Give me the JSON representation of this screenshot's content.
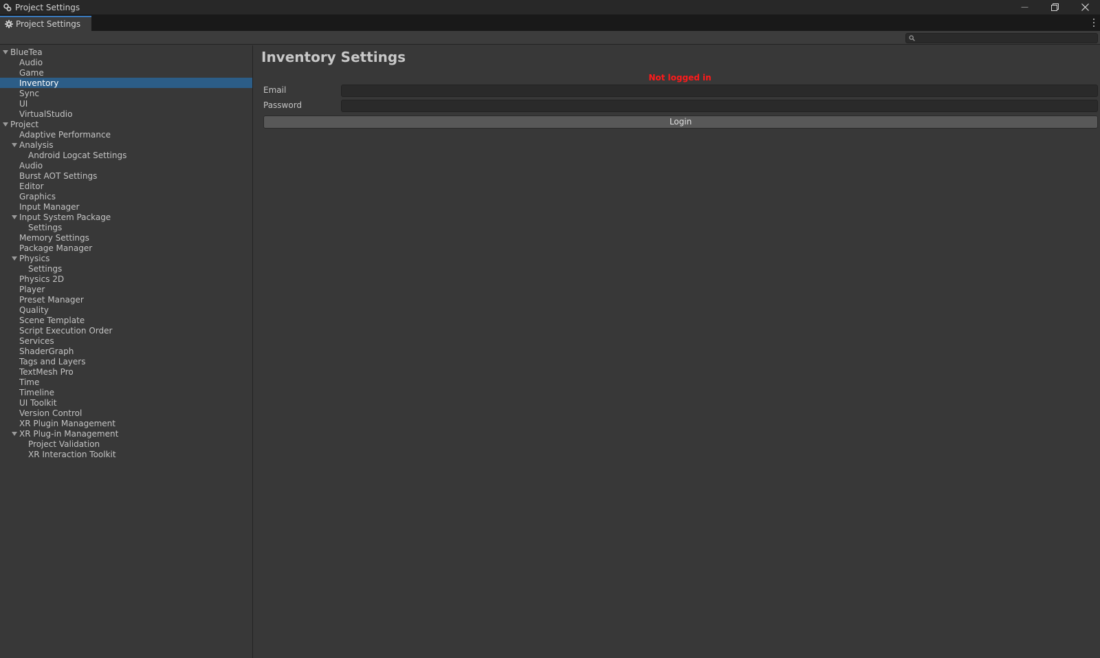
{
  "window": {
    "title": "Project Settings",
    "controls": {
      "minimize": "—",
      "restore": "❐",
      "close": "✕"
    }
  },
  "tab": {
    "label": "Project Settings"
  },
  "search": {
    "placeholder": ""
  },
  "sidebar": {
    "items": [
      {
        "label": "BlueTea",
        "level": 0,
        "expanded": true,
        "selected": false
      },
      {
        "label": "Audio",
        "level": 1,
        "selected": false
      },
      {
        "label": "Game",
        "level": 1,
        "selected": false
      },
      {
        "label": "Inventory",
        "level": 1,
        "selected": true
      },
      {
        "label": "Sync",
        "level": 1,
        "selected": false
      },
      {
        "label": "UI",
        "level": 1,
        "selected": false
      },
      {
        "label": "VirtualStudio",
        "level": 1,
        "selected": false
      },
      {
        "label": "Project",
        "level": 0,
        "expanded": true,
        "selected": false
      },
      {
        "label": "Adaptive Performance",
        "level": 1,
        "selected": false
      },
      {
        "label": "Analysis",
        "level": 1,
        "expanded": true,
        "selected": false
      },
      {
        "label": "Android Logcat Settings",
        "level": 2,
        "selected": false
      },
      {
        "label": "Audio",
        "level": 1,
        "selected": false
      },
      {
        "label": "Burst AOT Settings",
        "level": 1,
        "selected": false
      },
      {
        "label": "Editor",
        "level": 1,
        "selected": false
      },
      {
        "label": "Graphics",
        "level": 1,
        "selected": false
      },
      {
        "label": "Input Manager",
        "level": 1,
        "selected": false
      },
      {
        "label": "Input System Package",
        "level": 1,
        "expanded": true,
        "selected": false
      },
      {
        "label": "Settings",
        "level": 2,
        "selected": false
      },
      {
        "label": "Memory Settings",
        "level": 1,
        "selected": false
      },
      {
        "label": "Package Manager",
        "level": 1,
        "selected": false
      },
      {
        "label": "Physics",
        "level": 1,
        "expanded": true,
        "selected": false
      },
      {
        "label": "Settings",
        "level": 2,
        "selected": false
      },
      {
        "label": "Physics 2D",
        "level": 1,
        "selected": false
      },
      {
        "label": "Player",
        "level": 1,
        "selected": false
      },
      {
        "label": "Preset Manager",
        "level": 1,
        "selected": false
      },
      {
        "label": "Quality",
        "level": 1,
        "selected": false
      },
      {
        "label": "Scene Template",
        "level": 1,
        "selected": false
      },
      {
        "label": "Script Execution Order",
        "level": 1,
        "selected": false
      },
      {
        "label": "Services",
        "level": 1,
        "selected": false
      },
      {
        "label": "ShaderGraph",
        "level": 1,
        "selected": false
      },
      {
        "label": "Tags and Layers",
        "level": 1,
        "selected": false
      },
      {
        "label": "TextMesh Pro",
        "level": 1,
        "selected": false
      },
      {
        "label": "Time",
        "level": 1,
        "selected": false
      },
      {
        "label": "Timeline",
        "level": 1,
        "selected": false
      },
      {
        "label": "UI Toolkit",
        "level": 1,
        "selected": false
      },
      {
        "label": "Version Control",
        "level": 1,
        "selected": false
      },
      {
        "label": "XR Plugin Management",
        "level": 1,
        "selected": false
      },
      {
        "label": "XR Plug-in Management",
        "level": 1,
        "expanded": true,
        "selected": false
      },
      {
        "label": "Project Validation",
        "level": 2,
        "selected": false
      },
      {
        "label": "XR Interaction Toolkit",
        "level": 2,
        "selected": false
      }
    ]
  },
  "main": {
    "title": "Inventory Settings",
    "status": "Not logged in",
    "email": {
      "label": "Email",
      "value": ""
    },
    "password": {
      "label": "Password",
      "value": ""
    },
    "login_label": "Login"
  },
  "colors": {
    "status": "#ff1a1a",
    "selection": "#2c5d87",
    "tab_accent": "#3a79bb"
  }
}
